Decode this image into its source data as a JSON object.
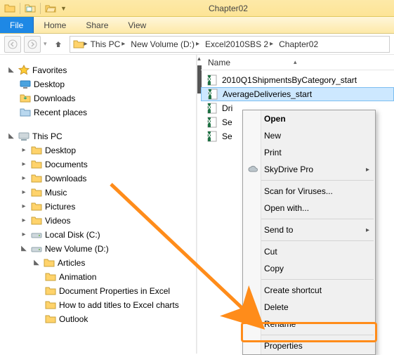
{
  "window": {
    "title": "Chapter02"
  },
  "ribbon": {
    "file": "File",
    "tabs": [
      "Home",
      "Share",
      "View"
    ]
  },
  "breadcrumb": {
    "segments": [
      "This PC",
      "New Volume (D:)",
      "Excel2010SBS 2",
      "Chapter02"
    ]
  },
  "navpane": {
    "favorites": {
      "label": "Favorites",
      "items": [
        "Desktop",
        "Downloads",
        "Recent places"
      ]
    },
    "thispc": {
      "label": "This PC",
      "items": [
        "Desktop",
        "Documents",
        "Downloads",
        "Music",
        "Pictures",
        "Videos",
        "Local Disk (C:)"
      ],
      "newvol": {
        "label": "New Volume (D:)",
        "articles": {
          "label": "Articles",
          "items": [
            "Animation",
            "Document Properties in Excel",
            "How to add titles to Excel charts",
            "Outlook"
          ]
        }
      }
    }
  },
  "filepane": {
    "colheader": "Name",
    "files": [
      "2010Q1ShipmentsByCategory_start",
      "AverageDeliveries_start",
      "Dri",
      "Se",
      "Se"
    ],
    "selected_index": 1
  },
  "context_menu": {
    "items": [
      {
        "label": "Open",
        "bold": true
      },
      {
        "label": "New"
      },
      {
        "label": "Print"
      },
      {
        "label": "SkyDrive Pro",
        "icon": "cloud",
        "submenu": true
      },
      {
        "sep": true
      },
      {
        "label": "Scan for Viruses..."
      },
      {
        "label": "Open with..."
      },
      {
        "sep": true
      },
      {
        "label": "Send to",
        "submenu": true
      },
      {
        "sep": true
      },
      {
        "label": "Cut"
      },
      {
        "label": "Copy"
      },
      {
        "sep": true
      },
      {
        "label": "Create shortcut"
      },
      {
        "label": "Delete"
      },
      {
        "label": "Rename"
      },
      {
        "sep": true
      },
      {
        "label": "Properties",
        "highlight": true
      }
    ]
  }
}
